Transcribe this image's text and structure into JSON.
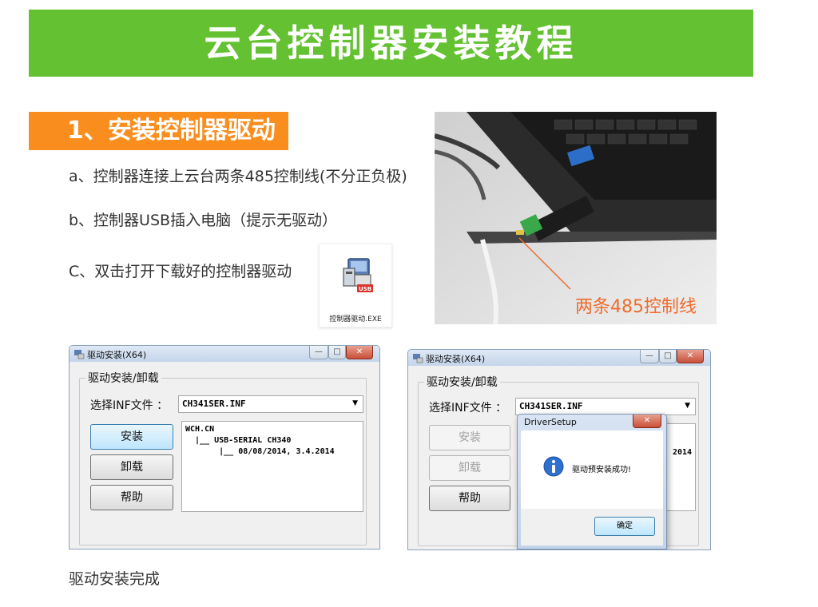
{
  "banner": {
    "title": "云台控制器安装教程"
  },
  "step1": {
    "heading": "1、安装控制器驱动",
    "instructions": [
      "a、控制器连接上云台两条485控制线(不分正负极)",
      "b、控制器USB插入电脑（提示无驱动）",
      "C、双击打开下载好的控制器驱动"
    ],
    "exe_label": "控制器驱动.EXE",
    "photo_caption": "两条485控制线",
    "final_note": "驱动安装完成"
  },
  "dialog_left": {
    "title": "驱动安装(X64)",
    "group_label": "驱动安装/卸载",
    "inf_label": "选择INF文件 ：",
    "inf_value": "CH341SER.INF",
    "buttons": {
      "install": "安装",
      "uninstall": "卸载",
      "help": "帮助"
    },
    "info_lines": [
      "WCH.CN",
      "  |__ USB-SERIAL CH340",
      "       |__ 08/08/2014, 3.4.2014"
    ]
  },
  "dialog_right": {
    "title": "驱动安装(X64)",
    "group_label": "驱动安装/卸载",
    "inf_label": "选择INF文件 ：",
    "inf_value": "CH341SER.INF",
    "buttons": {
      "install": "安装",
      "uninstall": "卸载",
      "help": "帮助"
    },
    "info_partial": "2014"
  },
  "msgbox": {
    "title": "DriverSetup",
    "message": "驱动预安装成功!",
    "ok_label": "确定"
  },
  "colors": {
    "banner_green": "#64c132",
    "step_orange": "#f98d1e",
    "caption_orange": "#ef6c2b"
  }
}
